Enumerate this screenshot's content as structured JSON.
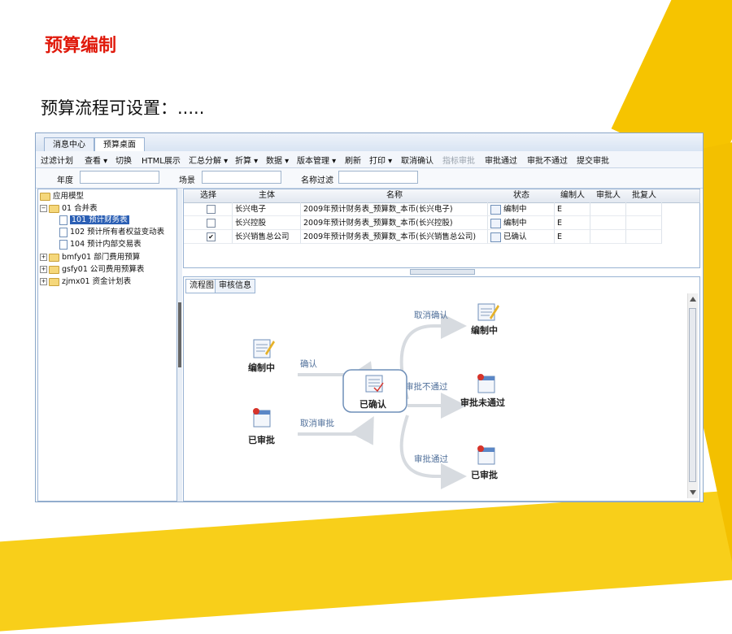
{
  "slide": {
    "heading": "预算编制",
    "subtitle": "预算流程可设置：....."
  },
  "app": {
    "tabs": [
      "消息中心",
      "预算桌面"
    ],
    "toolbar": {
      "items": [
        "过滤计划",
        "查看 ▾",
        "切换",
        "HTML展示",
        "汇总分解 ▾",
        "折算 ▾",
        "数据 ▾",
        "版本管理 ▾",
        "刷新",
        "打印 ▾",
        "取消确认",
        "指标审批",
        "审批通过",
        "审批不通过",
        "提交审批"
      ],
      "disabled_item": "指标审批"
    },
    "filters": {
      "year_label": "年度",
      "year_value": "",
      "scene_label": "场景",
      "scene_value": "",
      "name_filter_label": "名称过滤",
      "name_filter_value": ""
    },
    "tree": [
      {
        "label": "应用模型",
        "level": 0,
        "expander": "",
        "icon": "folder-icon"
      },
      {
        "label": "01 合并表",
        "level": 0,
        "expander": "-",
        "icon": "folder-icon"
      },
      {
        "label": "101 预计财务表",
        "level": 1,
        "expander": "",
        "icon": "document-icon",
        "selected": true
      },
      {
        "label": "102 预计所有者权益变动表",
        "level": 1,
        "expander": "",
        "icon": "document-icon"
      },
      {
        "label": "104 预计内部交易表",
        "level": 1,
        "expander": "",
        "icon": "document-icon"
      },
      {
        "label": "bmfy01 部门费用预算",
        "level": 0,
        "expander": "+",
        "icon": "folder-icon"
      },
      {
        "label": "gsfy01 公司费用预算表",
        "level": 0,
        "expander": "+",
        "icon": "folder-icon"
      },
      {
        "label": "zjmx01 资金计划表",
        "level": 0,
        "expander": "+",
        "icon": "folder-icon"
      }
    ],
    "table": {
      "columns": [
        "选择",
        "主体",
        "名称",
        "状态",
        "编制人",
        "审批人",
        "批复人"
      ],
      "rows": [
        {
          "checked": false,
          "entity": "长兴电子",
          "name": "2009年预计财务表_预算数_本币(长兴电子)",
          "status": "编制中",
          "preparer": "E",
          "approver": "",
          "reviewer": ""
        },
        {
          "checked": false,
          "entity": "长兴控股",
          "name": "2009年预计财务表_预算数_本币(长兴控股)",
          "status": "编制中",
          "preparer": "E",
          "approver": "",
          "reviewer": ""
        },
        {
          "checked": true,
          "entity": "长兴销售总公司",
          "name": "2009年预计财务表_预算数_本币(长兴销售总公司)",
          "status": "已确认",
          "preparer": "E",
          "approver": "",
          "reviewer": ""
        }
      ]
    },
    "flow_tabs": [
      "流程图",
      "审核信息"
    ],
    "flow": {
      "nodes": {
        "editing_left": "编制中",
        "approved_left": "已审批",
        "confirmed": "已确认",
        "editing_right": "编制中",
        "rejected": "审批未通过",
        "approved_right": "已审批"
      },
      "edges": {
        "confirm": "确认",
        "cancel_approval": "取消审批",
        "cancel_confirm": "取消确认",
        "reject": "审批不通过",
        "pass": "审批通过"
      }
    }
  },
  "colors": {
    "heading": "#e0190b",
    "accent_yellow": "#f6c400",
    "selection": "#2b5fb4"
  }
}
